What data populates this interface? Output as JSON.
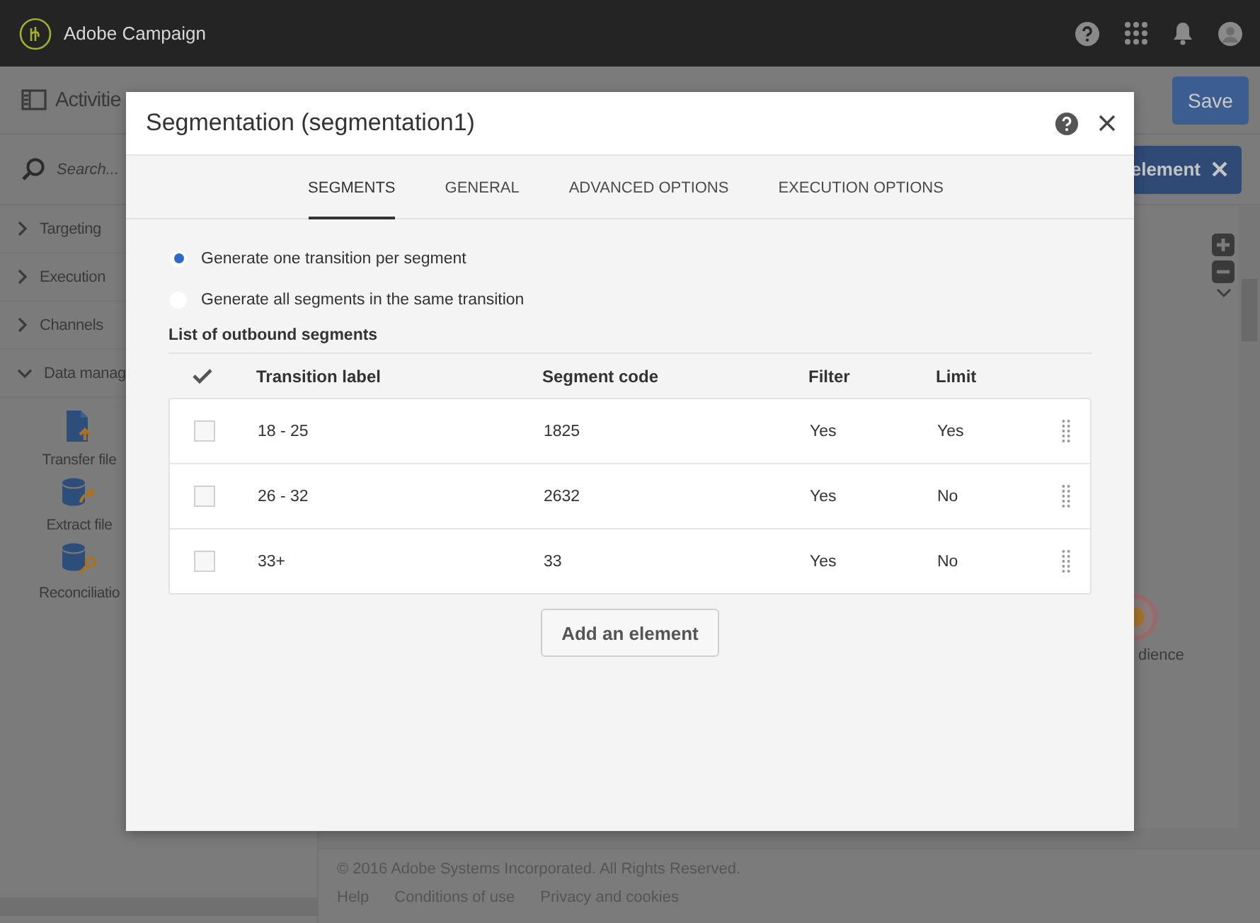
{
  "app": {
    "product": "Adobe Campaign"
  },
  "toolbar": {
    "title": "Activitie",
    "save": "Save"
  },
  "sidebar": {
    "search_placeholder": "Search...",
    "sections": [
      {
        "label": "Targeting",
        "expanded": false
      },
      {
        "label": "Execution",
        "expanded": false
      },
      {
        "label": "Channels",
        "expanded": false
      },
      {
        "label": "Data manag",
        "expanded": true,
        "items": [
          {
            "label": "Transfer file",
            "kind": "transfer"
          },
          {
            "label": "Extract file",
            "kind": "extract"
          },
          {
            "label": "Reconciliatio",
            "kind": "reconcile"
          }
        ]
      }
    ]
  },
  "selection_button": {
    "label": "element"
  },
  "canvas": {
    "nodes": [
      {
        "label": "dience"
      }
    ]
  },
  "footer": {
    "copyright": "© 2016 Adobe Systems Incorporated. All Rights Reserved.",
    "links": [
      "Help",
      "Conditions of use",
      "Privacy and cookies"
    ]
  },
  "dialog": {
    "title": "Segmentation (segmentation1)",
    "tabs": [
      {
        "label": "SEGMENTS",
        "selected": true
      },
      {
        "label": "GENERAL",
        "selected": false
      },
      {
        "label": "ADVANCED OPTIONS",
        "selected": false
      },
      {
        "label": "EXECUTION OPTIONS",
        "selected": false
      }
    ],
    "options": [
      {
        "label": "Generate one transition per segment",
        "selected": true
      },
      {
        "label": "Generate all segments in the same transition",
        "selected": false
      }
    ],
    "list_title": "List of outbound segments",
    "columns": [
      "Transition label",
      "Segment code",
      "Filter",
      "Limit"
    ],
    "rows": [
      {
        "cells": [
          "18 - 25",
          "1825",
          "Yes",
          "Yes"
        ],
        "checked": false
      },
      {
        "cells": [
          "26 - 32",
          "2632",
          "Yes",
          "No"
        ],
        "checked": false
      },
      {
        "cells": [
          "33+",
          "33",
          "Yes",
          "No"
        ],
        "checked": false
      }
    ],
    "add_button": "Add an element"
  }
}
